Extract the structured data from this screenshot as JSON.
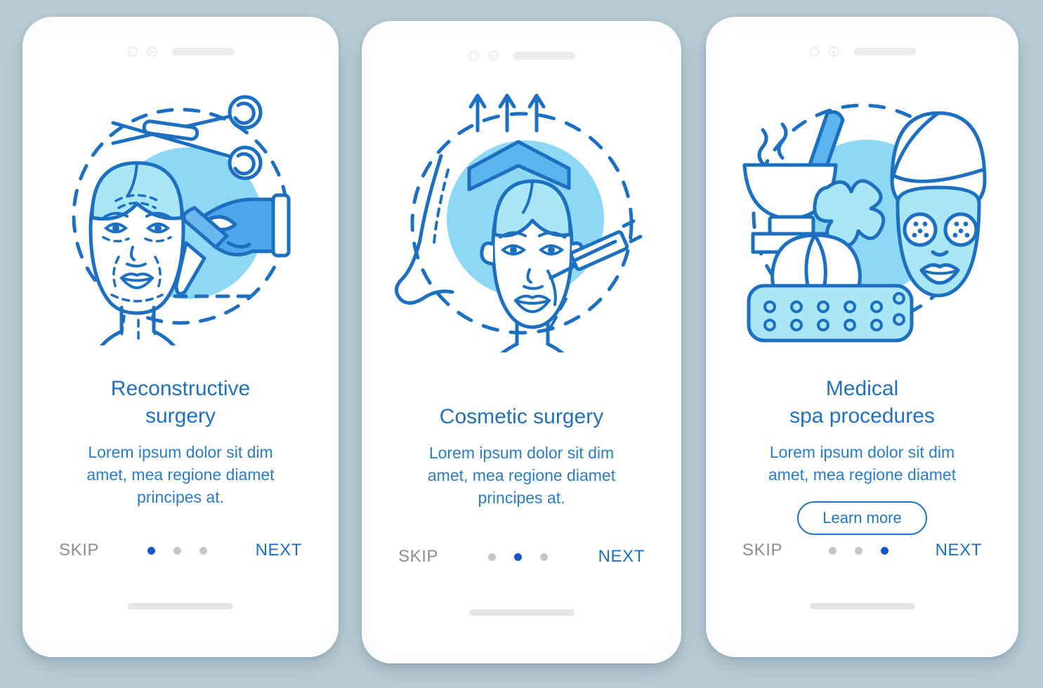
{
  "background_color": "#b9ccd6",
  "theme": {
    "title_color": "#2170b9",
    "subtitle_color": "#2c7cc4",
    "next_color": "#1b6fc4",
    "skip_color": "#8d8d8d",
    "active_dot_color": "#1458c7",
    "inactive_dot_color": "#c6c6c6",
    "line_color": "#1d6fc0",
    "blob_color": "#8fd8f5",
    "hair_color": "#a9e7f6",
    "glove_color": "#5bb4ee"
  },
  "screens": [
    {
      "id": "reconstructive-surgery",
      "title": "Reconstructive\nsurgery",
      "subtitle": "Lorem ipsum dolor sit dim\namet, mea regione diamet\nprincipes at.",
      "illustration": "face-with-scissors-and-scalpel-icon",
      "has_learn_more": false,
      "learn_more_label": "",
      "skip_label": "SKIP",
      "next_label": "NEXT",
      "dots": [
        true,
        false,
        false
      ],
      "active_index": 0
    },
    {
      "id": "cosmetic-surgery",
      "title": "Cosmetic surgery",
      "subtitle": "Lorem ipsum dolor sit dim\namet, mea regione diamet\nprincipes at.",
      "illustration": "face-with-syringe-and-lift-arrows-icon",
      "has_learn_more": false,
      "learn_more_label": "",
      "skip_label": "SKIP",
      "next_label": "NEXT",
      "dots": [
        false,
        true,
        false
      ],
      "active_index": 1
    },
    {
      "id": "medical-spa-procedures",
      "title": "Medical\nspa procedures",
      "subtitle": "Lorem ipsum dolor sit dim\namet, mea regione diamet",
      "illustration": "spa-mortar-towels-facemask-icon",
      "has_learn_more": true,
      "learn_more_label": "Learn more",
      "skip_label": "SKIP",
      "next_label": "NEXT",
      "dots": [
        false,
        false,
        true
      ],
      "active_index": 2
    }
  ]
}
